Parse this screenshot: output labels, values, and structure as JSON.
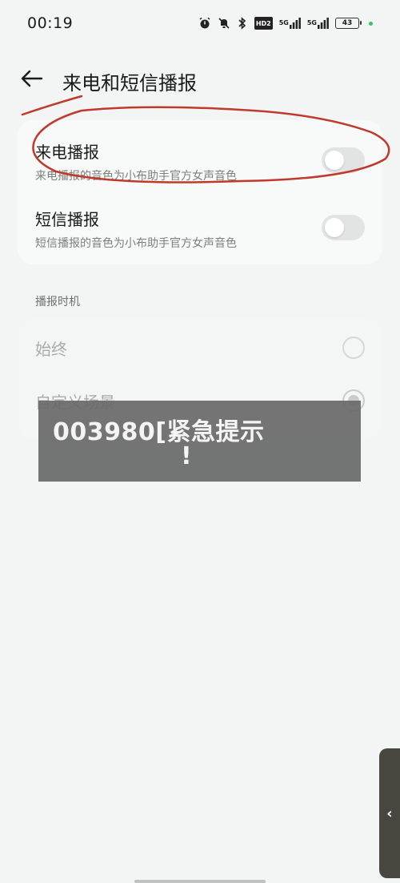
{
  "status_bar": {
    "time": "00:19",
    "hd_label": "HD2",
    "net1": "5G",
    "net2": "5G",
    "battery": "43",
    "icons": [
      "alarm-icon",
      "mute-icon",
      "bluetooth-icon",
      "hd-icon",
      "signal-icon",
      "signal-icon",
      "battery-icon"
    ]
  },
  "header": {
    "title": "来电和短信播报"
  },
  "settings": [
    {
      "title": "来电播报",
      "subtitle": "来电播报的音色为小布助手官方女声音色",
      "enabled": false
    },
    {
      "title": "短信播报",
      "subtitle": "短信播报的音色为小布助手官方女声音色",
      "enabled": false
    }
  ],
  "timing": {
    "section_title": "播报时机",
    "options": [
      {
        "label": "始终",
        "selected": false
      },
      {
        "label": "自定义场景",
        "selected": true
      }
    ]
  },
  "overlay": {
    "text": "003980[紧急提示",
    "exclaim": "!"
  },
  "side_tab": {
    "glyph": "‹"
  },
  "colors": {
    "background": "#f2f5f3",
    "annotation": "#c0392b",
    "overlay": "#696969"
  }
}
